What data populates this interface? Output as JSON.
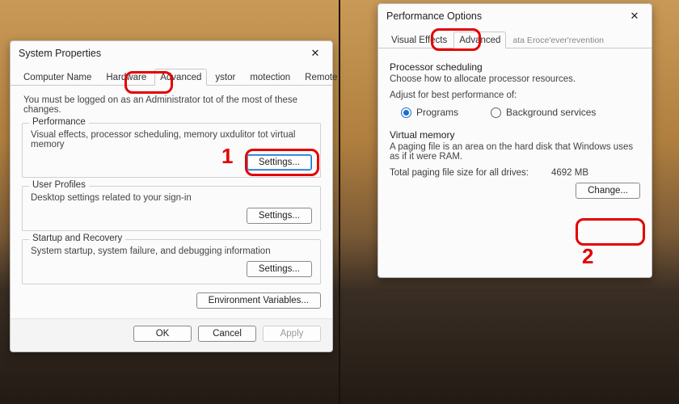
{
  "annotations": {
    "num1": "1",
    "num2": "2"
  },
  "dialog1": {
    "title": "System Properties",
    "tabs": [
      "Computer Name",
      "Hardware",
      "Advanced",
      "ystor",
      "motection",
      "Remote"
    ],
    "selected_tab": "Advanced",
    "note": "You must be logged on as an Administrator tot of the most of these changes.",
    "perf": {
      "title": "Performance",
      "desc": "Visual effects, processor scheduling, memory uxdulitor tot virtual memory",
      "button": "Settings..."
    },
    "profiles": {
      "title": "User Profiles",
      "desc": "Desktop settings related to your sign-in",
      "button": "Settings..."
    },
    "startup": {
      "title": "Startup and Recovery",
      "desc": "System startup, system failure, and debugging information",
      "button": "Settings..."
    },
    "env_button": "Environment Variables...",
    "footer": {
      "ok": "OK",
      "cancel": "Cancel",
      "apply": "Apply"
    }
  },
  "dialog2": {
    "title": "Performance Options",
    "tabs": [
      "Visual Effects",
      "Advanced",
      "ata Eroce'ever'revention"
    ],
    "selected_tab": "Advanced",
    "sched": {
      "head": "Processor scheduling",
      "sub": "Choose how to allocate processor resources.",
      "adjust": "Adjust for best performance of:",
      "programs": "Programs",
      "background": "Background services"
    },
    "vm": {
      "head": "Virtual memory",
      "desc": "A paging file is an area on the hard disk that Windows uses as if it were RAM.",
      "total_label": "Total paging file size for all drives:",
      "total_value": "4692 MB",
      "change": "Change..."
    }
  }
}
